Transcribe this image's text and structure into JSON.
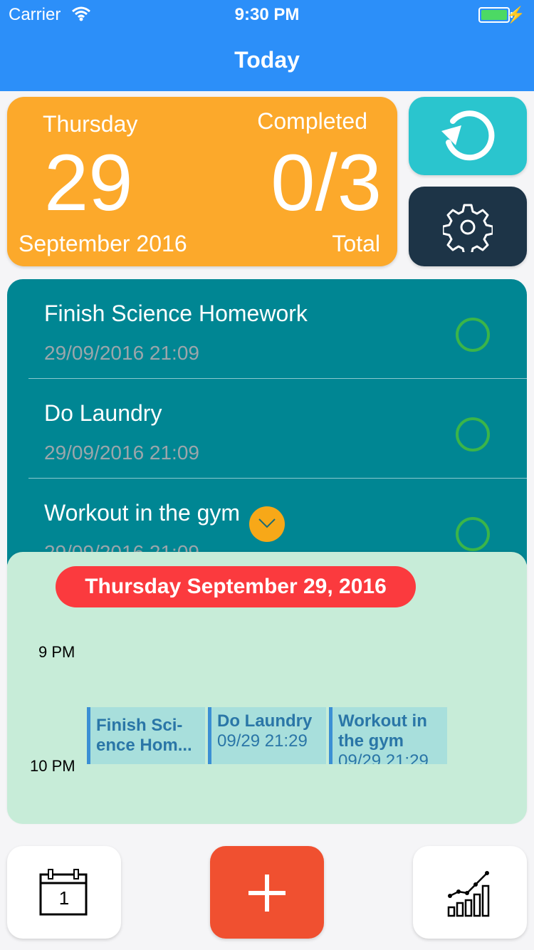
{
  "status_bar": {
    "carrier": "Carrier",
    "time": "9:30 PM"
  },
  "navbar": {
    "title": "Today"
  },
  "date_card": {
    "weekday": "Thursday",
    "day": "29",
    "month_year": "September 2016",
    "completed_label": "Completed",
    "count": "0/3",
    "total_label": "Total"
  },
  "tasks": [
    {
      "title": "Finish Science Homework",
      "datetime": "29/09/2016 21:09",
      "completed": false
    },
    {
      "title": "Do Laundry",
      "datetime": "29/09/2016 21:09",
      "completed": false
    },
    {
      "title": "Workout in the gym",
      "datetime": "29/09/2016 21:09",
      "completed": false
    }
  ],
  "calendar": {
    "date_header": "Thursday September 29, 2016",
    "hours": [
      "9 PM",
      "10 PM"
    ],
    "events": [
      {
        "title_line1": "Finish Sci-",
        "title_line2": "ence Hom...",
        "time": ""
      },
      {
        "title_line1": "Do Laundry",
        "title_line2": "",
        "time": "09/29 21:29"
      },
      {
        "title_line1": "Workout in",
        "title_line2": "the gym",
        "time": "09/29 21:29"
      }
    ]
  },
  "toolbar": {
    "calendar_day": "1"
  },
  "colors": {
    "nav_blue": "#2c8ff9",
    "date_card_orange": "#fca92b",
    "refresh_teal": "#2ac5ce",
    "settings_navy": "#1d3447",
    "task_list_teal": "#008693",
    "check_green": "#3bb549",
    "calendar_green": "#c7ecd8",
    "date_pill_red": "#fb3a3e",
    "add_button_red": "#f05030"
  },
  "icons": [
    "wifi-icon",
    "battery-icon",
    "refresh-icon",
    "gear-icon",
    "chevron-down-icon",
    "calendar-icon",
    "plus-icon",
    "stats-chart-icon"
  ]
}
